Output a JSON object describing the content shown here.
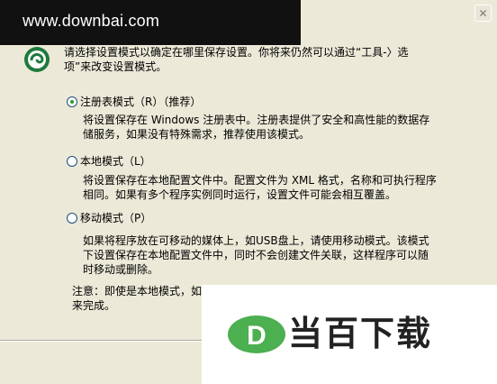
{
  "watermark": {
    "text": "www.downbai.com"
  },
  "titlebar": {
    "close_symbol": "✕"
  },
  "intro": {
    "text": "请选择设置模式以确定在哪里保存设置。你将来仍然可以通过“工具-〉选项”来改变设置模式。"
  },
  "options": [
    {
      "label": "注册表模式（R）（推荐）",
      "checked": true,
      "description": "将设置保存在 Windows 注册表中。注册表提供了安全和高性能的数据存储服务，如果没有特殊需求，推荐使用该模式。"
    },
    {
      "label": "本地模式（L）",
      "checked": false,
      "description": "将设置保存在本地配置文件中。配置文件为 XML 格式，名称和可执行程序相同。如果有多个程序实例同时运行，设置文件可能会相互覆盖。"
    },
    {
      "label": "移动模式（P）",
      "checked": false,
      "description": "如果将程序放在可移动的媒体上，如USB盘上，请使用移动模式。该模式下设置保存在本地配置文件中，同时不会创建文件关联，这样程序可以随时移动或删除。"
    }
  ],
  "note": {
    "line1": "注意：即使是本地模式，如",
    "line2": "来完成。"
  },
  "logo": {
    "text": "当百下载",
    "letter": "D"
  },
  "colors": {
    "dialog_bg": "#ECE9D8",
    "radio_dot": "#21A121",
    "logo_green": "#4CAF50"
  }
}
